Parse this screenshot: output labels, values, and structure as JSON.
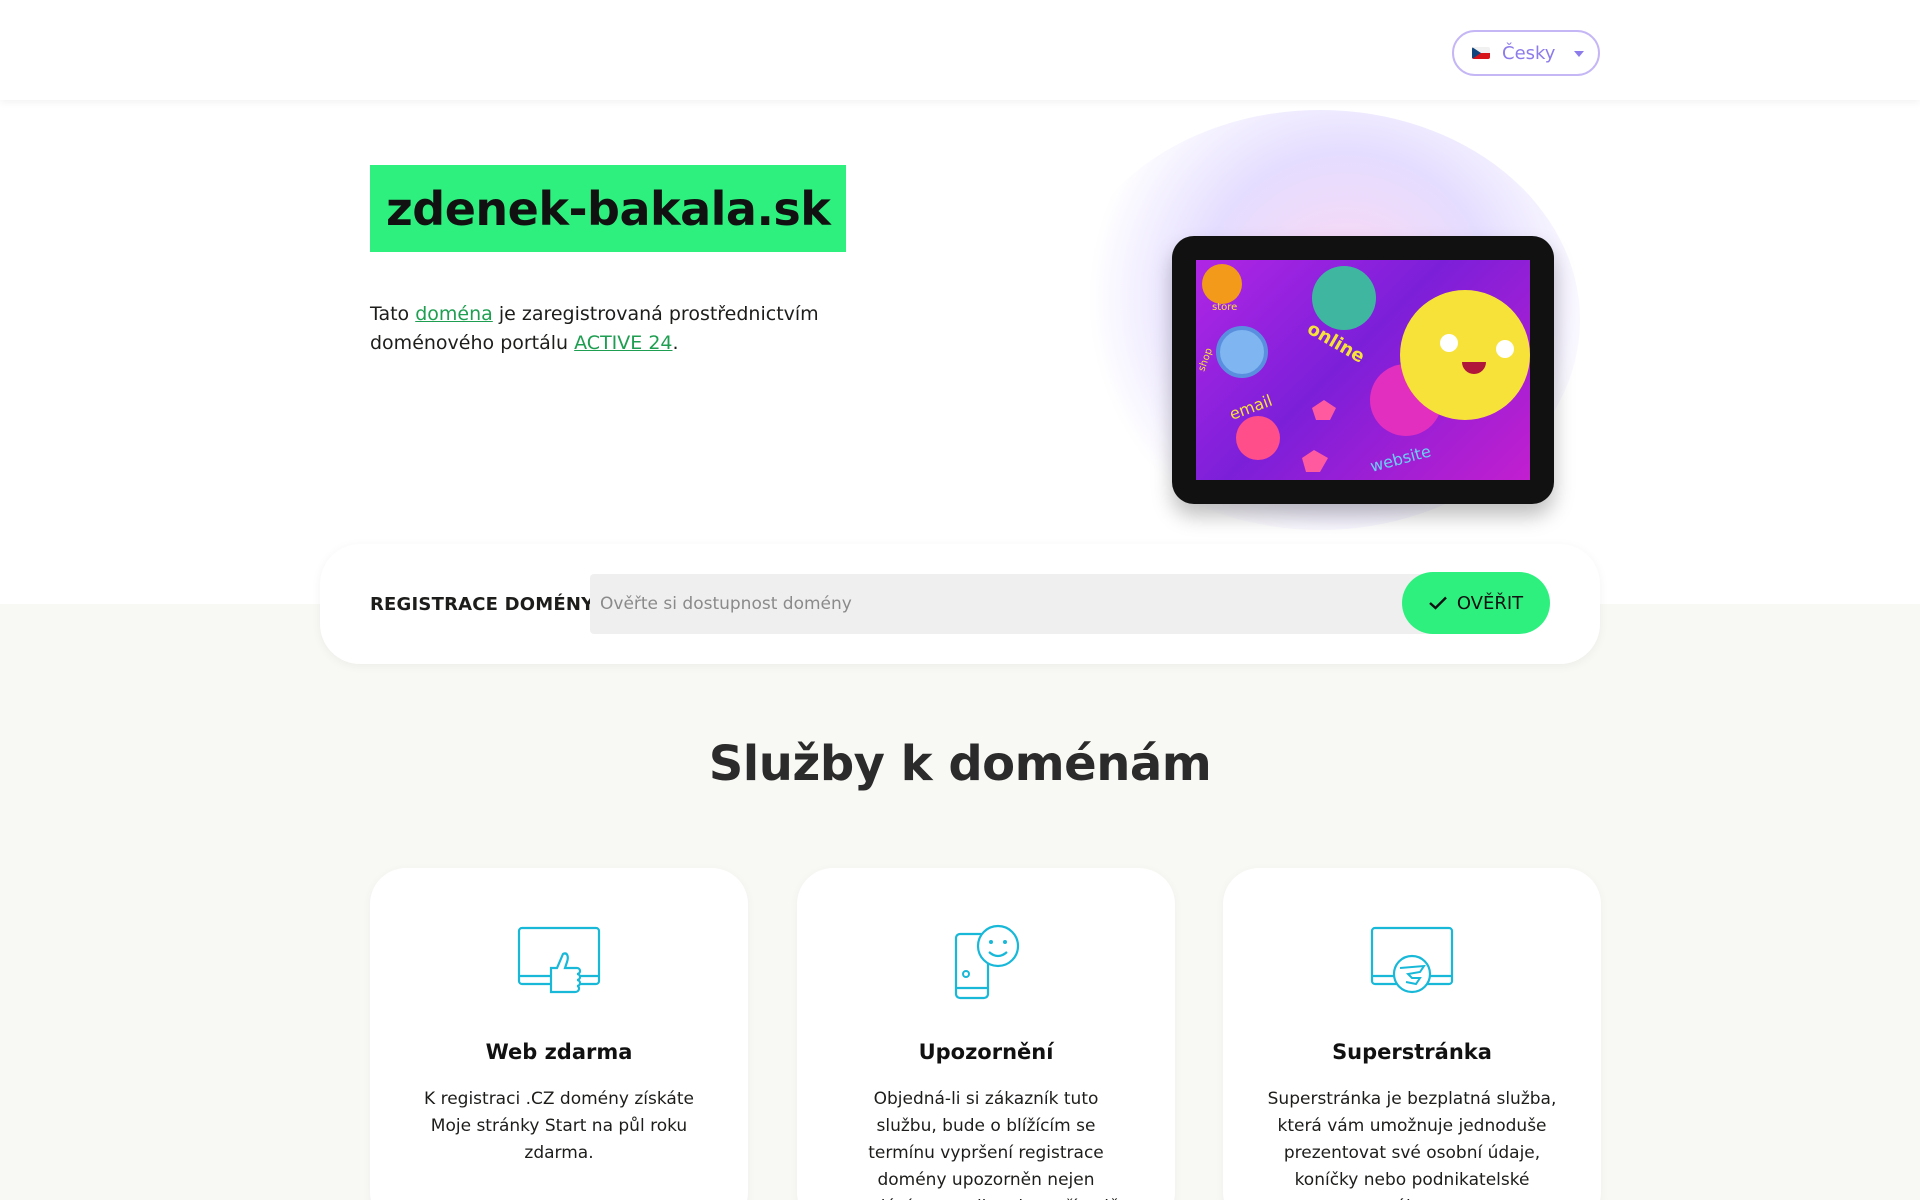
{
  "header": {
    "language": {
      "label": "Česky",
      "flag": "cz-flag-icon"
    }
  },
  "hero": {
    "domain": "zdenek-bakala.sk",
    "text_prefix": "Tato ",
    "link_domain": "doména",
    "text_middle": " je zaregistrovaná prostřednictvím doménového portálu ",
    "link_portal": "ACTIVE 24",
    "text_suffix": "."
  },
  "illustration": {
    "labels": [
      "online",
      "email",
      "website",
      "store",
      "shop"
    ]
  },
  "search": {
    "label": "REGISTRACE DOMÉNY",
    "placeholder": "Ověřte si dostupnost domény",
    "button_label": "OVĚŘIT"
  },
  "services": {
    "title": "Služby k doménám",
    "cards": [
      {
        "icon": "thumbs-up-monitor-icon",
        "title": "Web zdarma",
        "text": "K registraci .CZ domény získáte Moje stránky Start na půl roku zdarma."
      },
      {
        "icon": "phone-smiley-icon",
        "title": "Upozornění",
        "text": "Objedná-li si zákazník tuto službu, bude o blížícím se termínu vypršení registrace domény upozorněn nejen zasláním e-mailu, ale v případě"
      },
      {
        "icon": "monitor-superpage-icon",
        "title": "Superstránka",
        "text": "Superstránka je bezplatná služba, která vám umožnuje jednoduše prezentovat své osobní údaje, koníčky nebo podnikatelské zájmy"
      }
    ]
  },
  "colors": {
    "accent_green": "#2ef07f",
    "link_green": "#1e9e50",
    "lang_purple": "#8c7bea",
    "icon_cyan": "#18b8d8"
  }
}
